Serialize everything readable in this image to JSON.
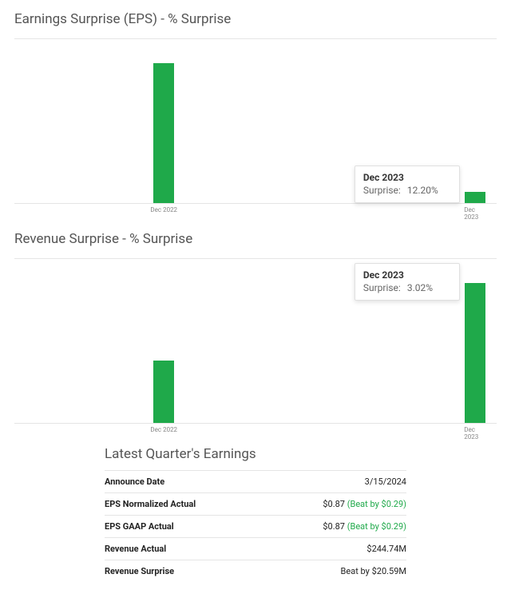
{
  "chart_data": [
    {
      "type": "bar",
      "title": "Earnings Surprise (EPS) - % Surprise",
      "categories": [
        "Dec 2022",
        "Dec 2023"
      ],
      "values": [
        155,
        12.2
      ],
      "ylim": [
        0,
        155
      ],
      "bar_color": "#1fa94a",
      "tooltip": {
        "category": "Dec 2023",
        "label": "Surprise:",
        "value": "12.20%"
      }
    },
    {
      "type": "bar",
      "title": "Revenue Surprise - % Surprise",
      "categories": [
        "Dec 2022",
        "Dec 2023"
      ],
      "values": [
        1.35,
        3.02
      ],
      "ylim": [
        0,
        3.02
      ],
      "bar_color": "#1fa94a",
      "tooltip": {
        "category": "Dec 2023",
        "label": "Surprise:",
        "value": "3.02%"
      }
    }
  ],
  "earnings": {
    "title": "Latest Quarter's Earnings",
    "rows": {
      "announce_date": {
        "label": "Announce Date",
        "value": "3/15/2024"
      },
      "eps_norm": {
        "label": "EPS Normalized Actual",
        "value": "$0.87",
        "beat": "(Beat by $0.29)"
      },
      "eps_gaap": {
        "label": "EPS GAAP Actual",
        "value": "$0.87",
        "beat": "(Beat by $0.29)"
      },
      "rev_actual": {
        "label": "Revenue Actual",
        "value": "$244.74M"
      },
      "rev_surprise": {
        "label": "Revenue Surprise",
        "beat": "Beat by $20.59M"
      }
    }
  }
}
